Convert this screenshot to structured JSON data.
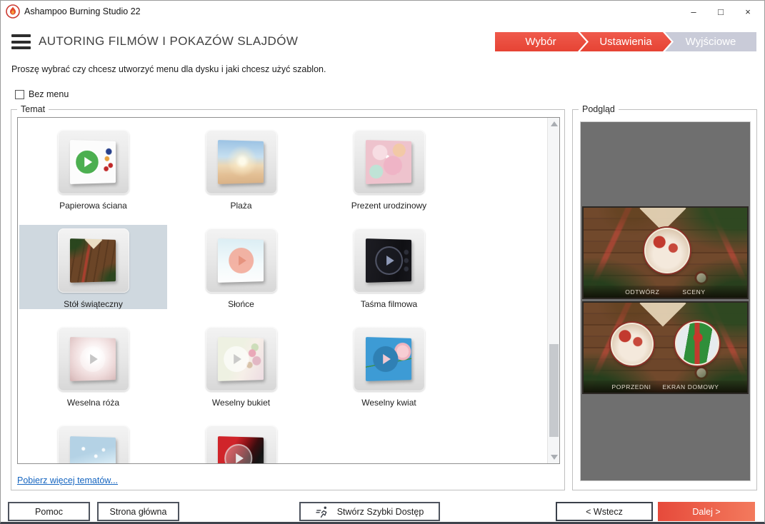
{
  "window": {
    "title": "Ashampoo Burning Studio 22",
    "controls": {
      "minimize": "–",
      "maximize": "□",
      "close": "×"
    }
  },
  "header": {
    "title": "AUTORING FILMÓW I POKAZÓW SLAJDÓW",
    "subtitle": "Proszę wybrać czy chcesz utworzyć menu dla dysku i jaki chcesz użyć szablon.",
    "steps": [
      {
        "label": "Wybór",
        "state": "done"
      },
      {
        "label": "Ustawienia",
        "state": "active"
      },
      {
        "label": "Wyjściowe",
        "state": "upcoming"
      }
    ]
  },
  "colors": {
    "step_red": "#ea4c3f",
    "step_gray": "#c9cbd8",
    "selection_blue": "#cfd8df",
    "link_blue": "#1565c0",
    "next_button_red": "#e64a3b",
    "preview_background_gray": "#6f6f6f"
  },
  "options": {
    "no_menu_label": "Bez menu",
    "no_menu_checked": false
  },
  "temat": {
    "group_label": "Temat",
    "more_link": "Pobierz więcej tematów...",
    "tiles": [
      {
        "label": "Papierowa ściana",
        "selected": false
      },
      {
        "label": "Plaża",
        "selected": false
      },
      {
        "label": "Prezent urodzinowy",
        "selected": false
      },
      {
        "label": "Stół świąteczny",
        "selected": true
      },
      {
        "label": "Słońce",
        "selected": false
      },
      {
        "label": "Taśma filmowa",
        "selected": false
      },
      {
        "label": "Weselna róża",
        "selected": false
      },
      {
        "label": "Weselny bukiet",
        "selected": false
      },
      {
        "label": "Weselny kwiat",
        "selected": false
      },
      {
        "label": "",
        "selected": false
      },
      {
        "label": "",
        "selected": false
      }
    ]
  },
  "preview": {
    "group_label": "Podgląd",
    "screens": [
      {
        "menu_items": [
          "ODTWÓRZ",
          "SCENY"
        ]
      },
      {
        "menu_items": [
          "POPRZEDNI",
          "EKRAN DOMOWY"
        ]
      }
    ]
  },
  "footer": {
    "help": "Pomoc",
    "home": "Strona główna",
    "quick_access": "Stwórz Szybki Dostęp",
    "back": "< Wstecz",
    "next": "Dalej >"
  }
}
